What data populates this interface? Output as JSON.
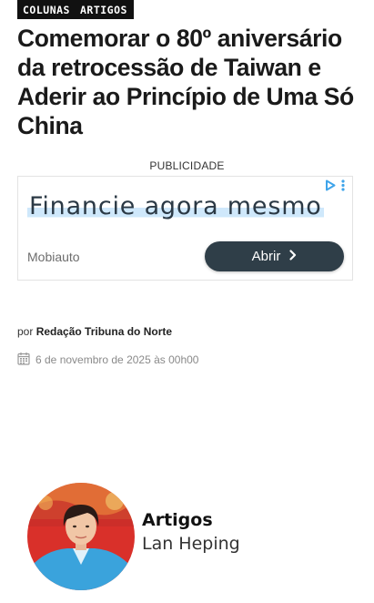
{
  "tags": [
    "COLUNAS",
    "ARTIGOS"
  ],
  "article": {
    "title": "Comemorar o 80º aniversário da retrocessão de Taiwan e Aderir ao Princípio de Uma Só China",
    "byline_prefix": "por",
    "author": "Redação Tribuna do Norte",
    "date": "6 de novembro de 2025 às 00h00"
  },
  "ad": {
    "label": "PUBLICIDADE",
    "headline": "Financie agora mesmo",
    "source": "Mobiauto",
    "button_label": "Abrir",
    "icons": [
      "adchoices-icon",
      "kebab-menu-icon",
      "chevron-right-icon"
    ]
  },
  "columnist": {
    "section": "Artigos",
    "name": "Lan Heping"
  },
  "icons": {
    "date": "calendar-icon"
  },
  "colors": {
    "tag_bg": "#111111",
    "ad_button_bg": "#2f3e48",
    "adchoices": "#3ea4ea",
    "avatar_bg": "#d9302a",
    "avatar_jacket": "#3aa3dc"
  }
}
